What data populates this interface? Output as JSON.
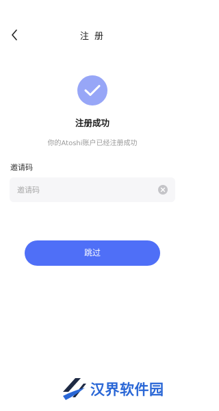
{
  "nav": {
    "title": "注 册"
  },
  "success": {
    "title": "注册成功",
    "description": "你的Atoshi账户已经注册成功"
  },
  "invite": {
    "label": "邀请码",
    "value": "",
    "placeholder": "邀请码"
  },
  "actions": {
    "skip_label": "跳过"
  },
  "watermark": {
    "text": "汉界软件园"
  },
  "colors": {
    "accent": "#4f6ff7",
    "success_icon_bg": "#97a6f7",
    "input_bg": "#f6f6f8",
    "watermark": "#2a67d6"
  },
  "icons": {
    "back": "chevron-left-icon",
    "success": "check-icon",
    "clear": "clear-icon",
    "logo": "logo-icon"
  }
}
